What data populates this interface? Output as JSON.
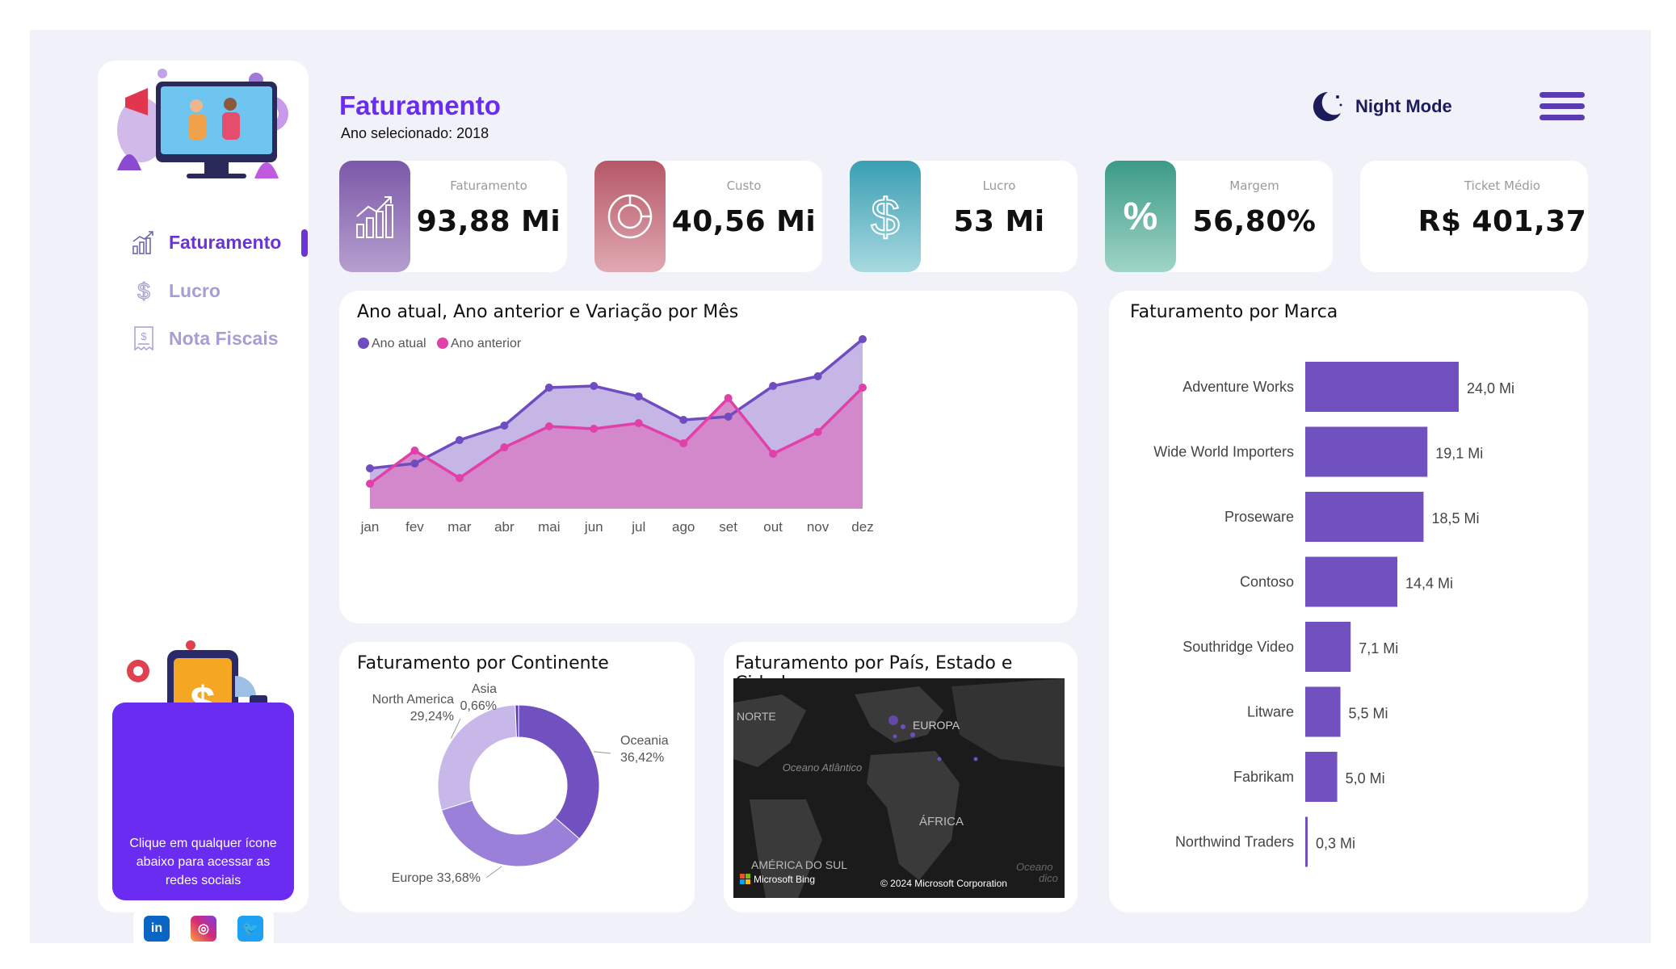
{
  "sidebar": {
    "nav": [
      {
        "label": "Faturamento",
        "icon": "bar-chart-icon",
        "active": true
      },
      {
        "label": "Lucro",
        "icon": "dollar-icon",
        "active": false
      },
      {
        "label": "Nota Fiscais",
        "icon": "receipt-icon",
        "active": false
      }
    ],
    "social_text": "Clique em qualquer ícone abaixo para acessar as redes sociais",
    "social": [
      {
        "label": "in",
        "icon": "linkedin-icon",
        "color": "#0a66c2"
      },
      {
        "label": "ig",
        "icon": "instagram-icon",
        "color": "#d62976"
      },
      {
        "label": "tw",
        "icon": "twitter-icon",
        "color": "#1da1f2"
      }
    ]
  },
  "header": {
    "title": "Faturamento",
    "subtitle": "Ano selecionado: 2018",
    "night_mode_label": "Night Mode"
  },
  "kpis": [
    {
      "label": "Faturamento",
      "value": "93,88 Mi",
      "icon": "growth-chart-icon",
      "gradient": [
        "#7b58a8",
        "#b69fcf"
      ]
    },
    {
      "label": "Custo",
      "value": "40,56 Mi",
      "icon": "donut-icon",
      "gradient": [
        "#b55766",
        "#e0a9b2"
      ]
    },
    {
      "label": "Lucro",
      "value": "53 Mi",
      "icon": "dollar-icon",
      "gradient": [
        "#3a9fb3",
        "#a8d9e0"
      ]
    },
    {
      "label": "Margem",
      "value": "56,80%",
      "icon": "percent-icon",
      "gradient": [
        "#3b9a86",
        "#9fd4c6"
      ]
    },
    {
      "label": "Ticket Médio",
      "value": "R$ 401,37",
      "icon": "",
      "gradient": []
    }
  ],
  "line_chart": {
    "title": "Ano atual, Ano anterior e Variação por Mês",
    "legend": [
      "Ano atual",
      "Ano anterior"
    ]
  },
  "bar_chart": {
    "title": "Faturamento por Marca"
  },
  "donut_chart": {
    "title": "Faturamento por Continente"
  },
  "map": {
    "title": "Faturamento por País, Estado e Cidade",
    "labels": {
      "norte": "NORTE",
      "europa": "EUROPA",
      "oceano": "Oceano Atlântico",
      "africa": "ÁFRICA",
      "america_sul": "AMÉRICA DO SUL",
      "oceano2": "Oceano",
      "indico": "dico"
    },
    "bing": "Microsoft Bing",
    "copyright": "© 2024 Microsoft Corporation"
  },
  "colors": {
    "accent": "#6a2cf0",
    "series_current": "#6f4cc0",
    "series_previous": "#e040a8",
    "bar": "#7150c0"
  },
  "chart_data": [
    {
      "type": "area",
      "title": "Ano atual, Ano anterior e Variação por Mês",
      "categories": [
        "jan",
        "fev",
        "mar",
        "abr",
        "mai",
        "jun",
        "jul",
        "ago",
        "set",
        "out",
        "nov",
        "dez"
      ],
      "series": [
        {
          "name": "Ano atual",
          "values": [
            5.0,
            5.6,
            8.5,
            10.3,
            15.0,
            15.2,
            13.9,
            11.0,
            11.4,
            15.2,
            16.4,
            21.0
          ]
        },
        {
          "name": "Ano anterior",
          "values": [
            3.1,
            7.2,
            3.8,
            7.6,
            10.2,
            9.9,
            10.6,
            8.1,
            13.7,
            6.8,
            9.5,
            15.0
          ]
        }
      ],
      "ylim": [
        0,
        22
      ],
      "legend": "top-left",
      "grid": false
    },
    {
      "type": "bar",
      "orientation": "horizontal",
      "title": "Faturamento por Marca",
      "categories": [
        "Adventure Works",
        "Wide World Importers",
        "Proseware",
        "Contoso",
        "Southridge Video",
        "Litware",
        "Fabrikam",
        "Northwind Traders"
      ],
      "values": [
        24.0,
        19.1,
        18.5,
        14.4,
        7.1,
        5.5,
        5.0,
        0.3
      ],
      "data_labels": [
        "24,0 Mi",
        "19,1 Mi",
        "18,5 Mi",
        "14,4 Mi",
        "7,1 Mi",
        "5,5 Mi",
        "5,0 Mi",
        "0,3 Mi"
      ],
      "xlim": [
        0,
        24
      ]
    },
    {
      "type": "pie",
      "donut": true,
      "title": "Faturamento por Continente",
      "categories": [
        "Oceania",
        "Europe",
        "North America",
        "Asia"
      ],
      "values": [
        36.42,
        33.68,
        29.24,
        0.66
      ],
      "data_labels": [
        "36,42%",
        "33,68%",
        "29,24%",
        "0,66%"
      ],
      "colors": [
        "#7150c0",
        "#9a80d8",
        "#c8b8ea",
        "#5a3ab0"
      ]
    }
  ]
}
